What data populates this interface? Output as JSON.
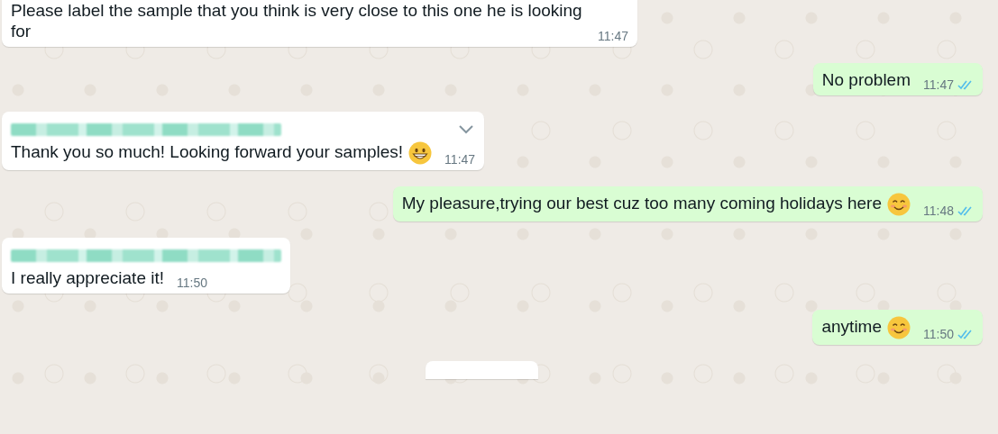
{
  "messages": [
    {
      "kind": "incoming",
      "sender_blurred": false,
      "chevron": false,
      "text": "Please label the sample that you think is very close to this one he is looking for",
      "time": "11:47"
    },
    {
      "kind": "outgoing",
      "text": "No problem",
      "time": "11:47",
      "read": true
    },
    {
      "kind": "incoming",
      "sender_blurred": true,
      "chevron": true,
      "text": "Thank you so much! Looking forward your samples!",
      "emoji": {
        "kind": "grin"
      },
      "time": "11:47"
    },
    {
      "kind": "outgoing",
      "text": "My pleasure,trying our best cuz too many coming holidays here",
      "emoji": {
        "kind": "smile"
      },
      "time": "11:48",
      "read": true
    },
    {
      "kind": "incoming",
      "sender_blurred": true,
      "chevron": false,
      "text": "I really appreciate it!",
      "time": "11:50"
    },
    {
      "kind": "outgoing",
      "text": "anytime",
      "emoji": {
        "kind": "smile"
      },
      "time": "11:50",
      "read": true
    }
  ],
  "date_divider": true
}
